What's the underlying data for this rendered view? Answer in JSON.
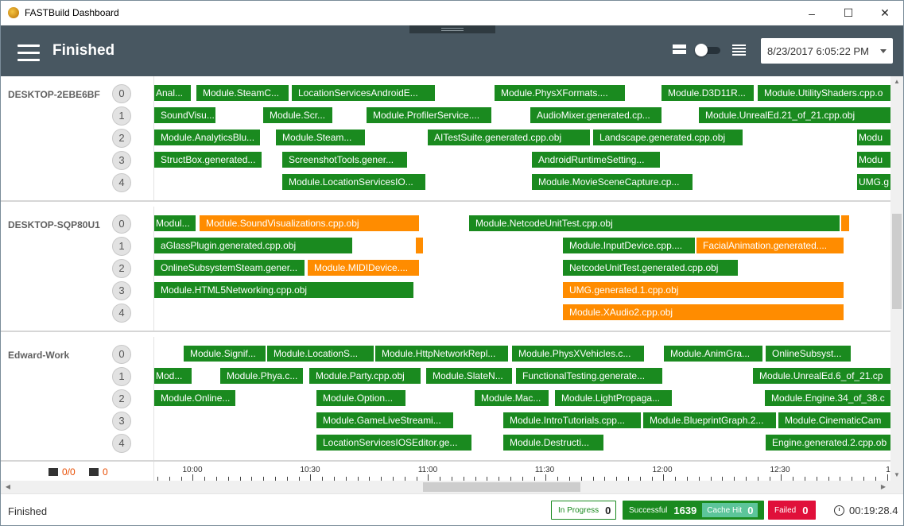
{
  "window": {
    "title": "FASTBuild Dashboard"
  },
  "header": {
    "title": "Finished",
    "date": "8/23/2017 6:05:22 PM"
  },
  "workers": [
    {
      "name": "DESKTOP-2EBE6BF",
      "cores": [
        "0",
        "1",
        "2",
        "3",
        "4"
      ],
      "jobs": [
        [
          [
            "Anal...",
            "g"
          ],
          [
            "Module.SteamC...",
            "g"
          ],
          [
            "LocationServicesAndroidE...",
            "g"
          ],
          [
            "Module.PhysXFormats....",
            "g"
          ],
          [
            "Module.D3D11R...",
            "g"
          ],
          [
            "Module.UtilityShaders.cpp.o",
            "g"
          ]
        ],
        [
          [
            "SoundVisu...",
            "g"
          ],
          [
            "Module.Scr...",
            "g"
          ],
          [
            "Module.ProfilerService....",
            "g"
          ],
          [
            "AudioMixer.generated.cp...",
            "g"
          ],
          [
            "Module.UnrealEd.21_of_21.cpp.obj",
            "g"
          ]
        ],
        [
          [
            "Module.AnalyticsBlu...",
            "g"
          ],
          [
            "Module.Steam...",
            "g"
          ],
          [
            "AITestSuite.generated.cpp.obj",
            "g"
          ],
          [
            "Landscape.generated.cpp.obj",
            "g"
          ],
          [
            "Modu",
            "g"
          ]
        ],
        [
          [
            "StructBox.generated...",
            "g"
          ],
          [
            "ScreenshotTools.gener...",
            "g"
          ],
          [
            "AndroidRuntimeSetting...",
            "g"
          ],
          [
            "Modu",
            "g"
          ]
        ],
        [
          [
            "Module.LocationServicesIO...",
            "g"
          ],
          [
            "Module.MovieSceneCapture.cp...",
            "g"
          ],
          [
            "UMG.g",
            "g"
          ]
        ]
      ]
    },
    {
      "name": "DESKTOP-SQP80U1",
      "cores": [
        "0",
        "1",
        "2",
        "3",
        "4"
      ],
      "jobs": [
        [
          [
            "Modul...",
            "g"
          ],
          [
            "Module.SoundVisualizations.cpp.obj",
            "o"
          ],
          [
            "Module.NetcodeUnitTest.cpp.obj",
            "g"
          ],
          [
            "",
            "o"
          ]
        ],
        [
          [
            "aGlassPlugin.generated.cpp.obj",
            "g"
          ],
          [
            "",
            "o"
          ],
          [
            "Module.InputDevice.cpp....",
            "g"
          ],
          [
            "FacialAnimation.generated....",
            "o"
          ]
        ],
        [
          [
            "OnlineSubsystemSteam.gener...",
            "g"
          ],
          [
            "Module.MIDIDevice....",
            "o"
          ],
          [
            "NetcodeUnitTest.generated.cpp.obj",
            "g"
          ]
        ],
        [
          [
            "Module.HTML5Networking.cpp.obj",
            "g"
          ],
          [
            "UMG.generated.1.cpp.obj",
            "o"
          ]
        ],
        [
          [
            "Module.XAudio2.cpp.obj",
            "o"
          ]
        ]
      ]
    },
    {
      "name": "Edward-Work",
      "cores": [
        "0",
        "1",
        "2",
        "3",
        "4"
      ],
      "jobs": [
        [
          [
            "Module.Signif...",
            "g"
          ],
          [
            "Module.LocationS...",
            "g"
          ],
          [
            "Module.HttpNetworkRepl...",
            "g"
          ],
          [
            "Module.PhysXVehicles.c...",
            "g"
          ],
          [
            "Module.AnimGra...",
            "g"
          ],
          [
            "OnlineSubsyst...",
            "g"
          ]
        ],
        [
          [
            "Mod...",
            "g"
          ],
          [
            "Module.Phya.c...",
            "g"
          ],
          [
            "Module.Party.cpp.obj",
            "g"
          ],
          [
            "Module.SlateN...",
            "g"
          ],
          [
            "FunctionalTesting.generate...",
            "g"
          ],
          [
            "Module.UnrealEd.6_of_21.cp",
            "g"
          ]
        ],
        [
          [
            "Module.Online...",
            "g"
          ],
          [
            "Module.Option...",
            "g"
          ],
          [
            "Module.Mac...",
            "g"
          ],
          [
            "Module.LightPropaga...",
            "g"
          ],
          [
            "Module.Engine.34_of_38.c",
            "g"
          ]
        ],
        [
          [
            "Module.GameLiveStreami...",
            "g"
          ],
          [
            "Module.IntroTutorials.cpp...",
            "g"
          ],
          [
            "Module.BlueprintGraph.2...",
            "g"
          ],
          [
            "Module.CinematicCam",
            "g"
          ]
        ],
        [
          [
            "LocationServicesIOSEditor.ge...",
            "g"
          ],
          [
            "Module.Destructi...",
            "g"
          ],
          [
            "Engine.generated.2.cpp.ob",
            "g"
          ]
        ]
      ]
    }
  ],
  "footer": {
    "workers_count": "0/0",
    "cores_count": "0"
  },
  "timeline": {
    "ticks": [
      "10:00",
      "10:30",
      "11:00",
      "11:30",
      "12:00",
      "12:30",
      "1"
    ]
  },
  "status": {
    "state": "Finished",
    "in_progress_label": "In Progress",
    "in_progress_value": "0",
    "successful_label": "Successful",
    "successful_value": "1639",
    "cache_hit_label": "Cache Hit",
    "cache_hit_value": "0",
    "failed_label": "Failed",
    "failed_value": "0",
    "elapsed": "00:19:28.4"
  },
  "colors": {
    "appbar": "#485761",
    "success": "#1a8a1f",
    "in_progress": "#ff8c00",
    "failed": "#e0103a",
    "cache_hit": "#5cc59a"
  }
}
